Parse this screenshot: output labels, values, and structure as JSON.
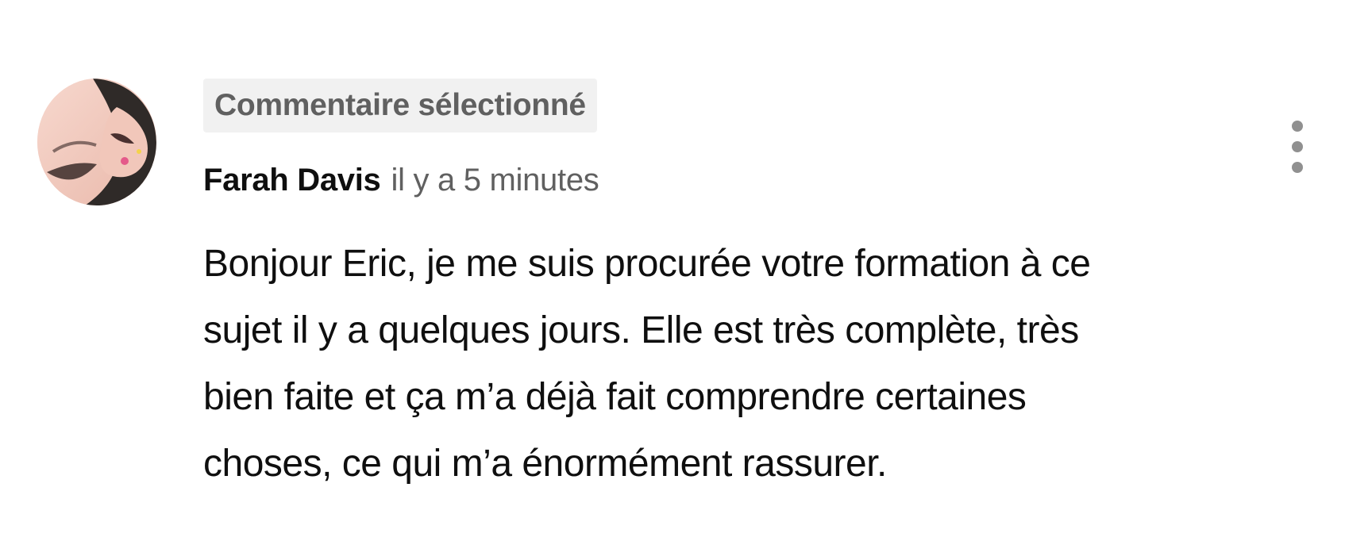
{
  "comment": {
    "avatar_icon": "profile-photo",
    "badge": "Commentaire sélectionné",
    "author": "Farah Davis",
    "timestamp": "il y a 5 minutes",
    "text_lines": [
      "Bonjour Eric, je me suis procurée votre formation à ce",
      "sujet il y a quelques jours. Elle est très complète, très",
      "bien faite et ça m’a déjà fait comprendre certaines",
      "choses, ce qui m’a énormément rassurer."
    ],
    "menu_icon": "more-vertical-icon"
  },
  "colors": {
    "badge_background": "#f1f1f1",
    "secondary_text": "#606060",
    "primary_text": "#0f0f0f",
    "menu_icon": "#909090"
  }
}
